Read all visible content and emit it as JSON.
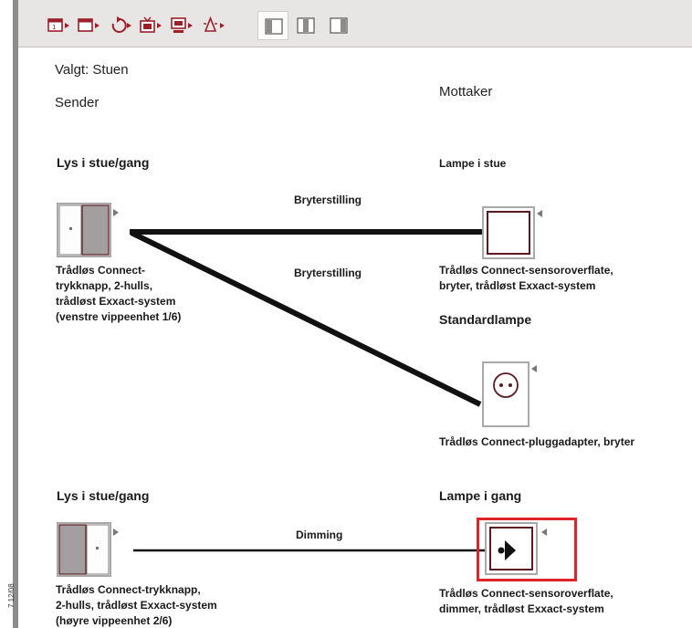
{
  "margin_code": "7 12/08",
  "toolbar": {
    "tools": [
      {
        "icon": "scene-1-icon",
        "color": "#9c1f2a"
      },
      {
        "icon": "scene-2-icon",
        "color": "#9c1f2a"
      },
      {
        "icon": "undo-icon",
        "color": "#9c1f2a"
      },
      {
        "icon": "tv-icon",
        "color": "#9c1f2a"
      },
      {
        "icon": "monitor-icon",
        "color": "#9c1f2a"
      },
      {
        "icon": "alarm-icon",
        "color": "#9c1f2a"
      }
    ],
    "views": [
      {
        "icon": "view-left-pane-icon",
        "selected": true
      },
      {
        "icon": "view-split-pane-icon",
        "selected": false
      },
      {
        "icon": "view-right-pane-icon",
        "selected": false
      }
    ]
  },
  "header": {
    "selected": "Valgt: Stuen",
    "sender": "Sender",
    "receiver": "Mottaker"
  },
  "group1": {
    "sender_title": "Lys i stue/gang",
    "sender_desc": "Trådløs Connect-\ntrykknapp, 2-hulls,\ntrådløst Exxact-system\n(venstre vippeenhet 1/6)",
    "link_label_1": "Bryterstilling",
    "link_label_2": "Bryterstilling",
    "receiver1_title": "Lampe i stue",
    "receiver1_desc": "Trådløs Connect-sensoroverflate,\nbryter, trådløst Exxact-system",
    "receiver2_title": "Standardlampe",
    "receiver2_desc": "Trådløs Connect-pluggadapter, bryter"
  },
  "group2": {
    "sender_title": "Lys i stue/gang",
    "sender_desc": "Trådløs Connect-trykknapp,\n2-hulls, trådløst Exxact-system\n(høyre vippeenhet 2/6)",
    "link_label": "Dimming",
    "receiver_title": "Lampe i gang",
    "receiver_desc": "Trådløs Connect-sensoroverflate,\ndimmer, trådløst Exxact-system"
  },
  "colors": {
    "accent": "#9c1f2a",
    "highlight": "#e0222a",
    "device_frame": "#a9a9a9",
    "connection_line": "#111111"
  }
}
